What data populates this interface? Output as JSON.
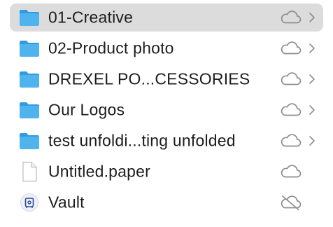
{
  "items": [
    {
      "name": "01-Creative",
      "type": "folder",
      "status": "cloud-icon",
      "expandable": true,
      "selected": true
    },
    {
      "name": "02-Product photo",
      "type": "folder",
      "status": "cloud-icon",
      "expandable": true,
      "selected": false
    },
    {
      "name": "DREXEL PO...CESSORIES",
      "type": "folder",
      "status": "cloud-icon",
      "expandable": true,
      "selected": false
    },
    {
      "name": "Our Logos",
      "type": "folder",
      "status": "cloud-icon",
      "expandable": true,
      "selected": false
    },
    {
      "name": "test unfoldi...ting unfolded",
      "type": "folder",
      "status": "cloud-icon",
      "expandable": true,
      "selected": false
    },
    {
      "name": "Untitled.paper",
      "type": "document",
      "status": "cloud-icon",
      "expandable": false,
      "selected": false
    },
    {
      "name": "Vault",
      "type": "vault",
      "status": "cloud-off-icon",
      "expandable": false,
      "selected": false
    }
  ],
  "colors": {
    "selection": "#dcdcdc",
    "folder_body": "#4fb3ee",
    "folder_tab": "#2f9be0",
    "icon_gray": "#8e8e93"
  }
}
